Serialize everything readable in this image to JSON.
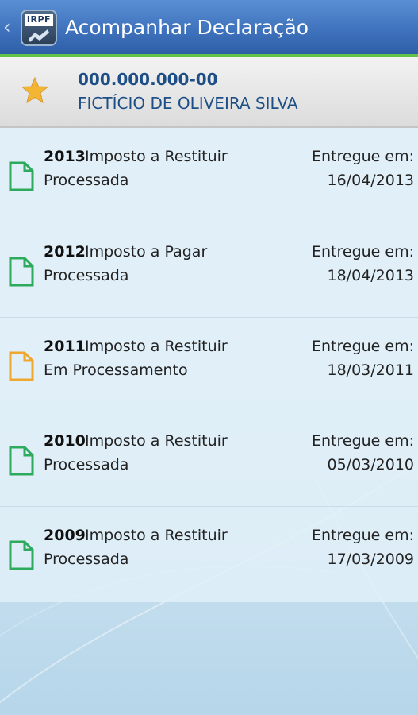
{
  "appbar": {
    "title": "Acompanhar Declaração",
    "logo_text": "IRPF",
    "back_icon": "chevron-left-icon",
    "color": "#3f73bd",
    "accent_color": "#62c247"
  },
  "taxpayer": {
    "cpf": "000.000.000-00",
    "name": "FICTÍCIO DE OLIVEIRA SILVA",
    "icon": "star-icon",
    "star_color": "#f2b632"
  },
  "declarations": [
    {
      "year": "2013",
      "type": "Imposto a Restituir",
      "status": "Processada",
      "delivered_label": "Entregue em:",
      "date": "16/04/2013",
      "icon_color": "#2eaa5c"
    },
    {
      "year": "2012",
      "type": "Imposto a Pagar",
      "status": "Processada",
      "delivered_label": "Entregue em:",
      "date": "18/04/2013",
      "icon_color": "#2eaa5c"
    },
    {
      "year": "2011",
      "type": "Imposto a Restituir",
      "status": "Em Processamento",
      "delivered_label": "Entregue em:",
      "date": "18/03/2011",
      "icon_color": "#f0a72e"
    },
    {
      "year": "2010",
      "type": "Imposto a Restituir",
      "status": "Processada",
      "delivered_label": "Entregue em:",
      "date": "05/03/2010",
      "icon_color": "#2eaa5c"
    },
    {
      "year": "2009",
      "type": "Imposto a Restituir",
      "status": "Processada",
      "delivered_label": "Entregue em:",
      "date": "17/03/2009",
      "icon_color": "#2eaa5c"
    }
  ]
}
